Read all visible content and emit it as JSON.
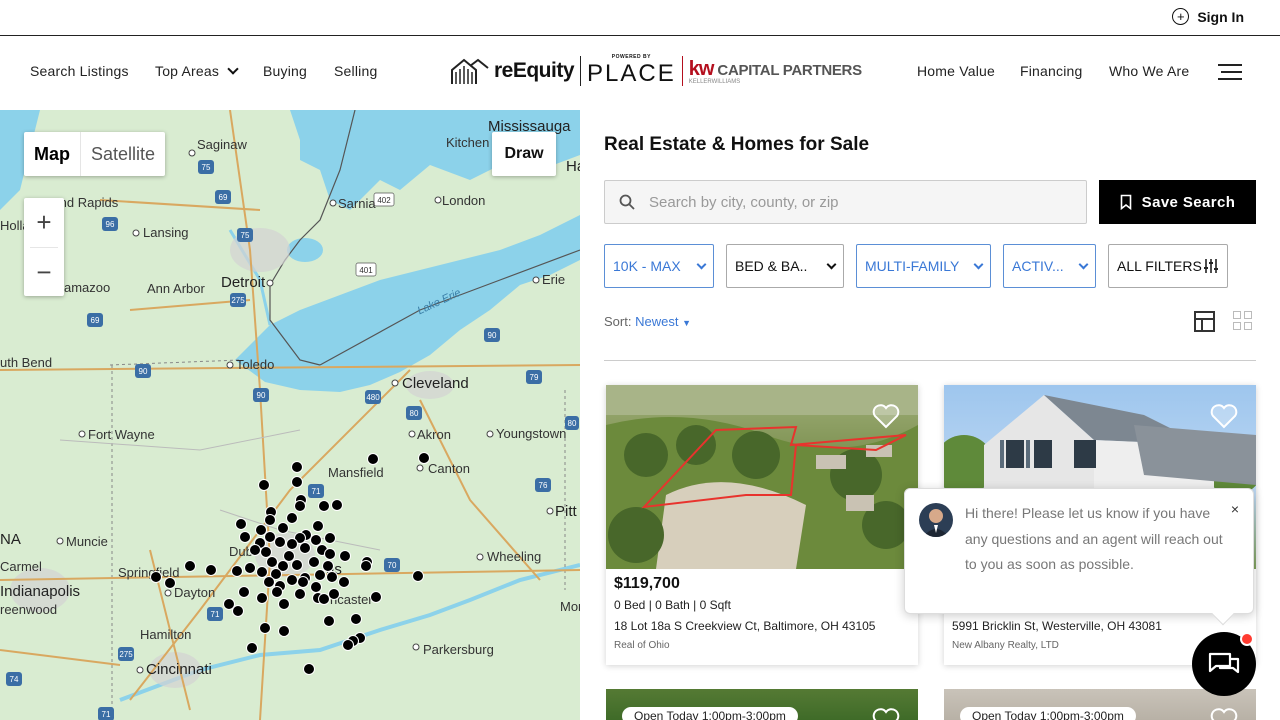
{
  "topbar": {
    "signin_label": "Sign In"
  },
  "nav": {
    "left": [
      "Search Listings",
      "Top Areas",
      "Buying",
      "Selling"
    ],
    "right": [
      "Home Value",
      "Financing",
      "Who We Are"
    ],
    "logo": {
      "brand1": "reEquity",
      "powered": "POWERED BY",
      "brand2": "PLACE",
      "kw": "kw",
      "cp": "CAPITAL PARTNERS",
      "sub": "KELLERWILLIAMS",
      "group": "GROUP"
    }
  },
  "map": {
    "type_map": "Map",
    "type_satellite": "Satellite",
    "draw": "Draw",
    "zoom_in": "+",
    "zoom_out": "−",
    "labels": {
      "mississauga": "Mississauga",
      "kitchener": "Kitchen",
      "ha": "Ha",
      "saginaw": "Saginaw",
      "grand_rapids": "Grand Rapids",
      "holland": "Holla",
      "lansing": "Lansing",
      "sarnia": "Sarnia",
      "london": "London",
      "detroit": "Detroit",
      "ann_arbor": "Ann Arbor",
      "kalamazoo": "amazoo",
      "toledo": "Toledo",
      "south_bend": "uth Bend",
      "erie": "Erie",
      "cleveland": "Cleveland",
      "akron": "Akron",
      "youngstown": "Youngstown",
      "fort_wayne": "Fort Wayne",
      "mansfield": "Mansfield",
      "canton": "Canton",
      "pitt": "Pitt",
      "muncie": "Muncie",
      "na": "NA",
      "dayton": "Dayton",
      "carmel": "Carmel",
      "indianapolis": "Indianapolis",
      "springfield": "Springfield",
      "greenwood": "reenwood",
      "wheeling": "Wheeling",
      "hamilton": "Hamilton",
      "cincinnati": "Cincinnati",
      "parkersburg": "Parkersburg",
      "morgantown": "Mor",
      "lancaster": "ncaster",
      "dublin": "Dubl",
      "lake_erie": "Lake Erie",
      "columbus": "us"
    },
    "shields": [
      "75",
      "69",
      "402",
      "96",
      "75",
      "401",
      "94",
      "69",
      "275",
      "90",
      "90",
      "90",
      "280",
      "480",
      "80",
      "79",
      "76",
      "71",
      "70",
      "71",
      "70",
      "275",
      "275",
      "71",
      "74",
      "79"
    ]
  },
  "listings": {
    "title": "Real Estate & Homes for Sale",
    "search_placeholder": "Search by city, county, or zip",
    "save_search": "Save Search",
    "filters": {
      "price": "10K - MAX",
      "bedbath": "BED & BA..",
      "type": "MULTI-FAMILY",
      "status": "ACTIV...",
      "all": "ALL FILTERS"
    },
    "sort_label": "Sort:",
    "sort_value": "Newest",
    "cards": [
      {
        "price": "$119,700",
        "beds": "0 Bed | 0 Bath | 0 Sqft",
        "address": "18 Lot 18a S Creekview Ct, Baltimore, OH 43105",
        "broker": "Real of Ohio"
      },
      {
        "address": "5991 Bricklin St, Westerville, OH 43081",
        "broker": "New Albany Realty, LTD"
      },
      {
        "open": "Open Today 1:00pm-3:00pm"
      },
      {
        "open": "Open Today 1:00pm-3:00pm"
      }
    ]
  },
  "chat": {
    "message": "Hi there! Please let us know if you have any questions and an agent will reach out to you as soon as possible.",
    "close": "×"
  }
}
